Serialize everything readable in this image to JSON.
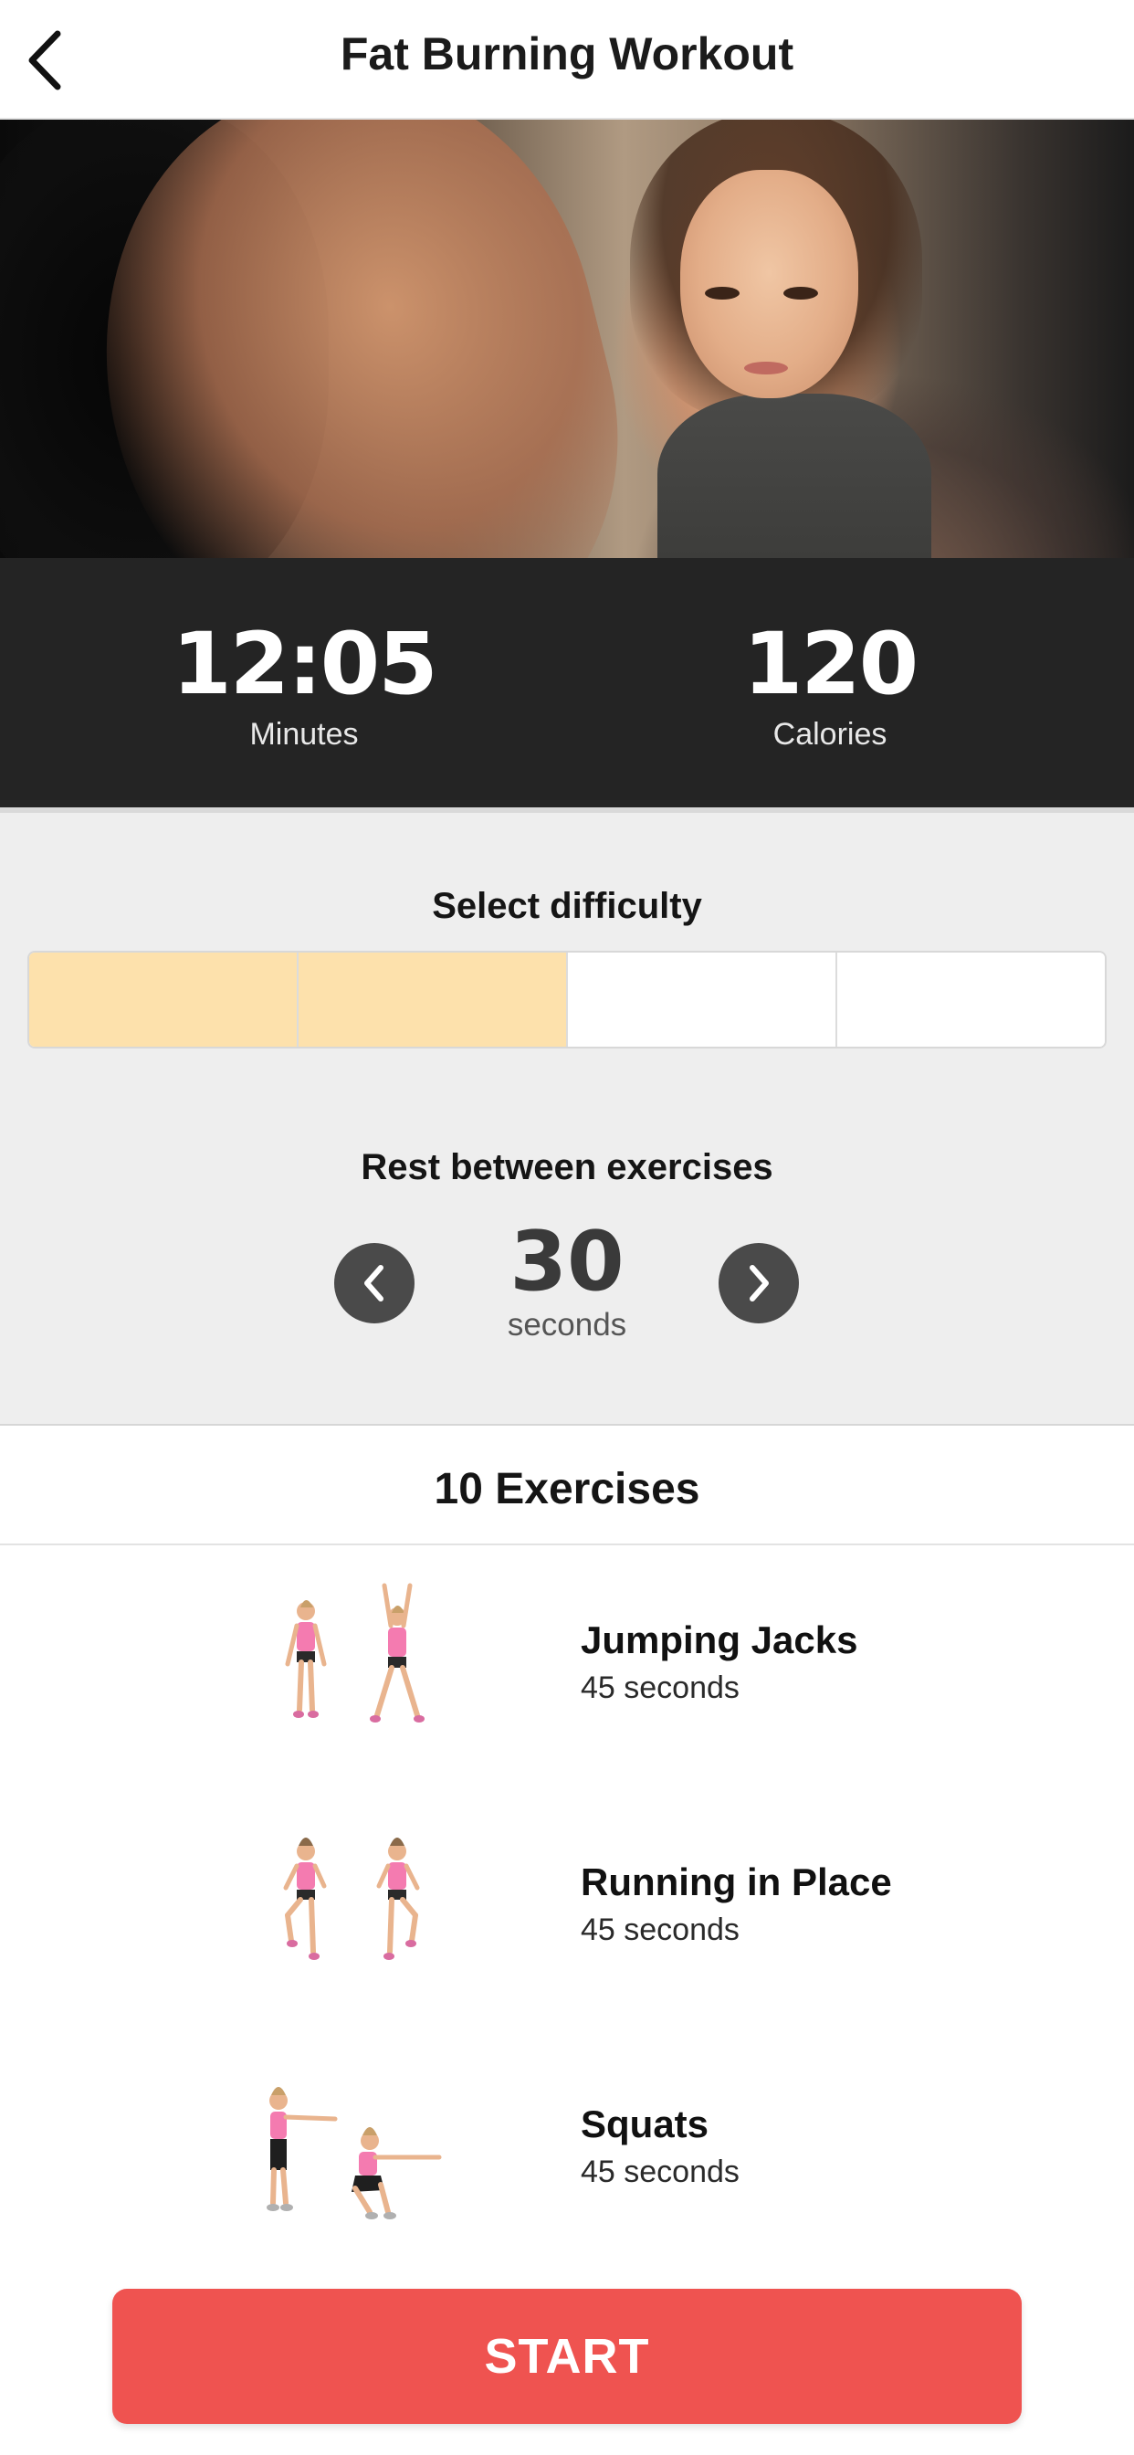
{
  "header": {
    "title": "Fat Burning Workout",
    "back_icon": "chevron-left-icon"
  },
  "stats": {
    "minutes_value": "12:05",
    "minutes_label": "Minutes",
    "calories_value": "120",
    "calories_label": "Calories"
  },
  "difficulty": {
    "title": "Select difficulty",
    "levels_total": 4,
    "levels_selected": 2,
    "selected_color": "#fde1ac"
  },
  "rest": {
    "title": "Rest between exercises",
    "value": "30",
    "unit": "seconds",
    "prev_icon": "chevron-left-icon",
    "next_icon": "chevron-right-icon"
  },
  "exercises": {
    "count_label": "10 Exercises",
    "items": [
      {
        "name": "Jumping Jacks",
        "duration": "45 seconds"
      },
      {
        "name": "Running in Place",
        "duration": "45 seconds"
      },
      {
        "name": "Squats",
        "duration": "45 seconds"
      }
    ]
  },
  "start_button": {
    "label": "START"
  },
  "colors": {
    "accent": "#ef5350",
    "stats_bg": "#242424",
    "settings_bg": "#eeeeee"
  }
}
